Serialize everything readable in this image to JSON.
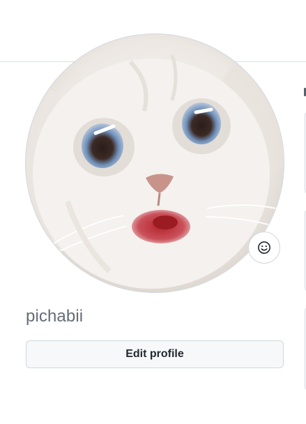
{
  "profile": {
    "username": "pichabii",
    "edit_button_label": "Edit profile",
    "avatar_alt": "pichabii"
  },
  "icons": {
    "status": "smiley-icon"
  },
  "colors": {
    "border": "#d0d7de",
    "username_text": "#636c76",
    "button_bg": "#f6f8fa",
    "button_text": "#24292f"
  }
}
